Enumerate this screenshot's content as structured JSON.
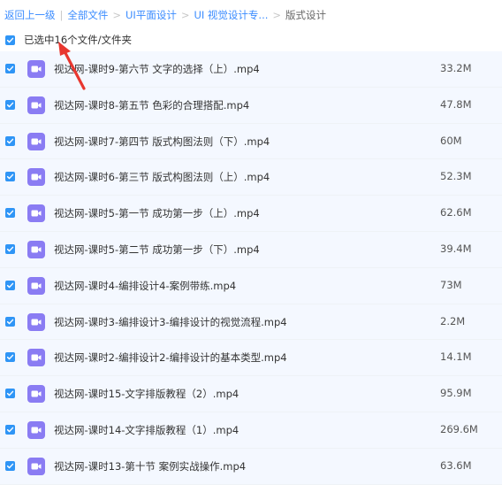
{
  "breadcrumb": {
    "back": "返回上一级",
    "all_files": "全部文件",
    "level1": "UI平面设计",
    "level2": "UI 视觉设计专...",
    "current": "版式设计"
  },
  "selection": {
    "text": "已选中16个文件/文件夹"
  },
  "files": [
    {
      "name": "视达网-课时9-第六节 文字的选择（上）.mp4",
      "size": "33.2M"
    },
    {
      "name": "视达网-课时8-第五节 色彩的合理搭配.mp4",
      "size": "47.8M"
    },
    {
      "name": "视达网-课时7-第四节 版式构图法则（下）.mp4",
      "size": "60M"
    },
    {
      "name": "视达网-课时6-第三节 版式构图法则（上）.mp4",
      "size": "52.3M"
    },
    {
      "name": "视达网-课时5-第一节 成功第一步（上）.mp4",
      "size": "62.6M"
    },
    {
      "name": "视达网-课时5-第二节 成功第一步（下）.mp4",
      "size": "39.4M"
    },
    {
      "name": "视达网-课时4-编排设计4-案例带练.mp4",
      "size": "73M"
    },
    {
      "name": "视达网-课时3-编排设计3-编排设计的视觉流程.mp4",
      "size": "2.2M"
    },
    {
      "name": "视达网-课时2-编排设计2-编排设计的基本类型.mp4",
      "size": "14.1M"
    },
    {
      "name": "视达网-课时15-文字排版教程（2）.mp4",
      "size": "95.9M"
    },
    {
      "name": "视达网-课时14-文字排版教程（1）.mp4",
      "size": "269.6M"
    },
    {
      "name": "视达网-课时13-第十节 案例实战操作.mp4",
      "size": "63.6M"
    }
  ],
  "colors": {
    "link": "#3b8cff",
    "checkbox": "#2f95f6",
    "video_icon": "#8a7cf3",
    "row_selected_bg": "#f4f8ff",
    "annotation_arrow": "#e8372f"
  },
  "icons": {
    "checkbox": "check-icon",
    "file": "video-file-icon",
    "annotation": "red-arrow-icon"
  }
}
